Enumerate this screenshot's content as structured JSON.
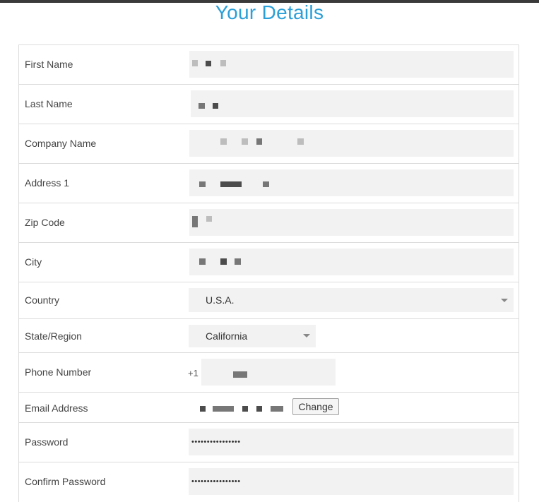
{
  "page": {
    "title": "Your Details"
  },
  "fields": {
    "first_name": {
      "label": "First Name"
    },
    "last_name": {
      "label": "Last Name"
    },
    "company_name": {
      "label": "Company Name"
    },
    "address1": {
      "label": "Address 1"
    },
    "zip_code": {
      "label": "Zip Code"
    },
    "city": {
      "label": "City"
    },
    "country": {
      "label": "Country",
      "value": "U.S.A."
    },
    "state": {
      "label": "State/Region",
      "value": "California"
    },
    "phone": {
      "label": "Phone Number",
      "prefix": "+1"
    },
    "email": {
      "label": "Email Address",
      "change_label": "Change"
    },
    "password": {
      "label": "Password",
      "value": "••••••••••••••••"
    },
    "confirm_password": {
      "label": "Confirm Password",
      "value": "••••••••••••••••"
    }
  },
  "colors": {
    "title": "#2a9fd8",
    "input_bg": "#f2f2f2",
    "border": "#dcdcdc"
  }
}
